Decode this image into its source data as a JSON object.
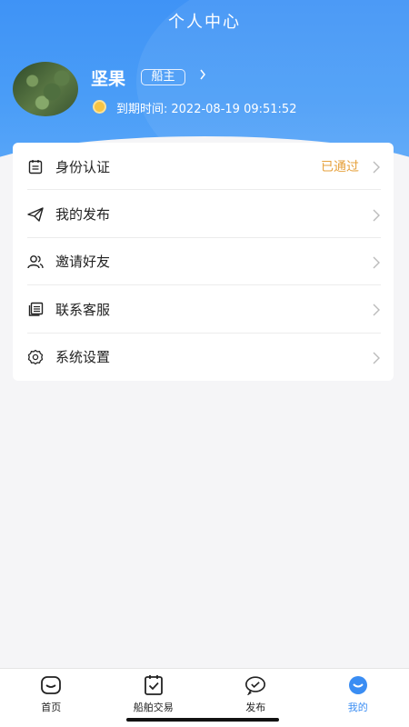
{
  "header": {
    "title": "个人中心"
  },
  "profile": {
    "name": "坚果",
    "role_badge": "船主",
    "expire_label": "到期时间:",
    "expire_value": "2022-08-19 09:51:52"
  },
  "menu": {
    "items": [
      {
        "label": "身份认证",
        "status": "已通过",
        "icon": "id-card-icon"
      },
      {
        "label": "我的发布",
        "status": "",
        "icon": "paper-plane-icon"
      },
      {
        "label": "邀请好友",
        "status": "",
        "icon": "users-icon"
      },
      {
        "label": "联系客服",
        "status": "",
        "icon": "document-stack-icon"
      },
      {
        "label": "系统设置",
        "status": "",
        "icon": "gear-icon"
      }
    ],
    "status_color": "#e6a13c"
  },
  "tabbar": {
    "items": [
      {
        "label": "首页",
        "icon": "home-icon",
        "active": false
      },
      {
        "label": "船舶交易",
        "icon": "ship-trade-icon",
        "active": false
      },
      {
        "label": "发布",
        "icon": "publish-icon",
        "active": false
      },
      {
        "label": "我的",
        "icon": "profile-icon",
        "active": true
      }
    ],
    "active_color": "#3a8df3"
  },
  "theme": {
    "brand_blue": "#3f93f6"
  }
}
